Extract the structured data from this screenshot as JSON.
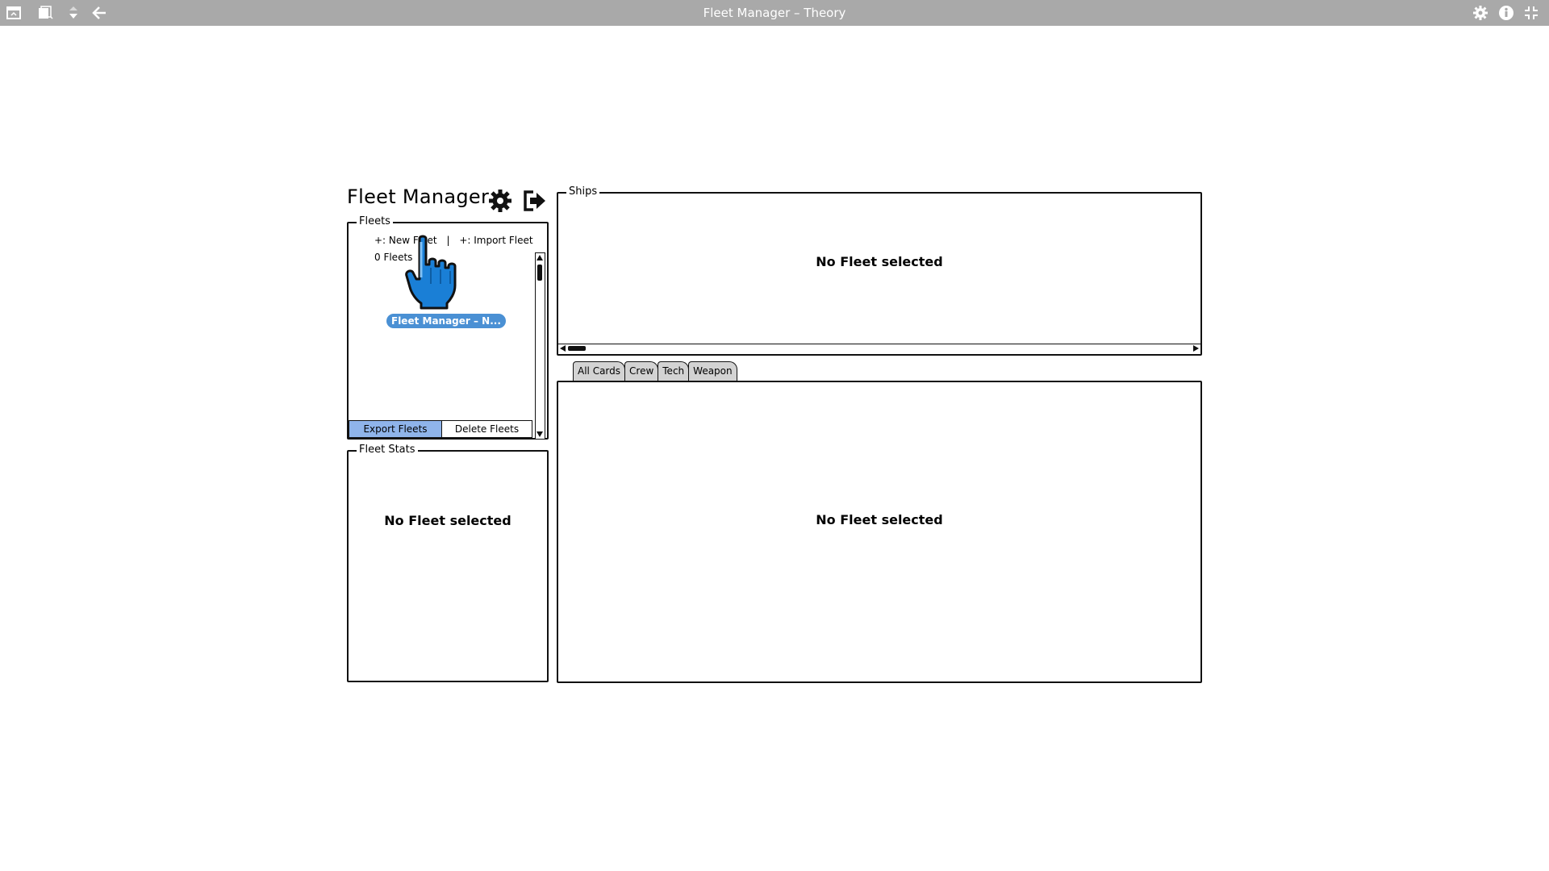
{
  "window": {
    "title": "Fleet Manager – Theory"
  },
  "header": {
    "app_title": "Fleet Manager"
  },
  "fleets_panel": {
    "legend": "Fleets",
    "new_fleet": "+: New Fleet",
    "separator": "|",
    "import_fleet": "+: Import Fleet",
    "count": "0 Fleets",
    "tooltip": "Fleet Manager – N...",
    "export_button": "Export Fleets",
    "delete_button": "Delete Fleets"
  },
  "fleet_stats_panel": {
    "legend": "Fleet Stats",
    "empty_message": "No Fleet selected"
  },
  "ships_panel": {
    "legend": "Ships",
    "empty_message": "No Fleet selected"
  },
  "tabs": [
    {
      "label": "All Cards"
    },
    {
      "label": "Crew"
    },
    {
      "label": "Tech"
    },
    {
      "label": "Weapon"
    }
  ],
  "cards_panel": {
    "empty_message": "No Fleet selected"
  },
  "colors": {
    "topbar": "#a9a9a9",
    "primary_button": "#8fb4ea",
    "tooltip": "#4a90d4",
    "cursor": "#1a7fd6",
    "tab": "#d3d3d3"
  },
  "icons": {
    "topbar_left": [
      "window-icon",
      "copy-icon",
      "sort-icon",
      "back-arrow-icon"
    ],
    "topbar_right": [
      "gear-icon",
      "info-icon",
      "collapse-icon"
    ],
    "header": [
      "settings-icon",
      "logout-icon"
    ]
  }
}
